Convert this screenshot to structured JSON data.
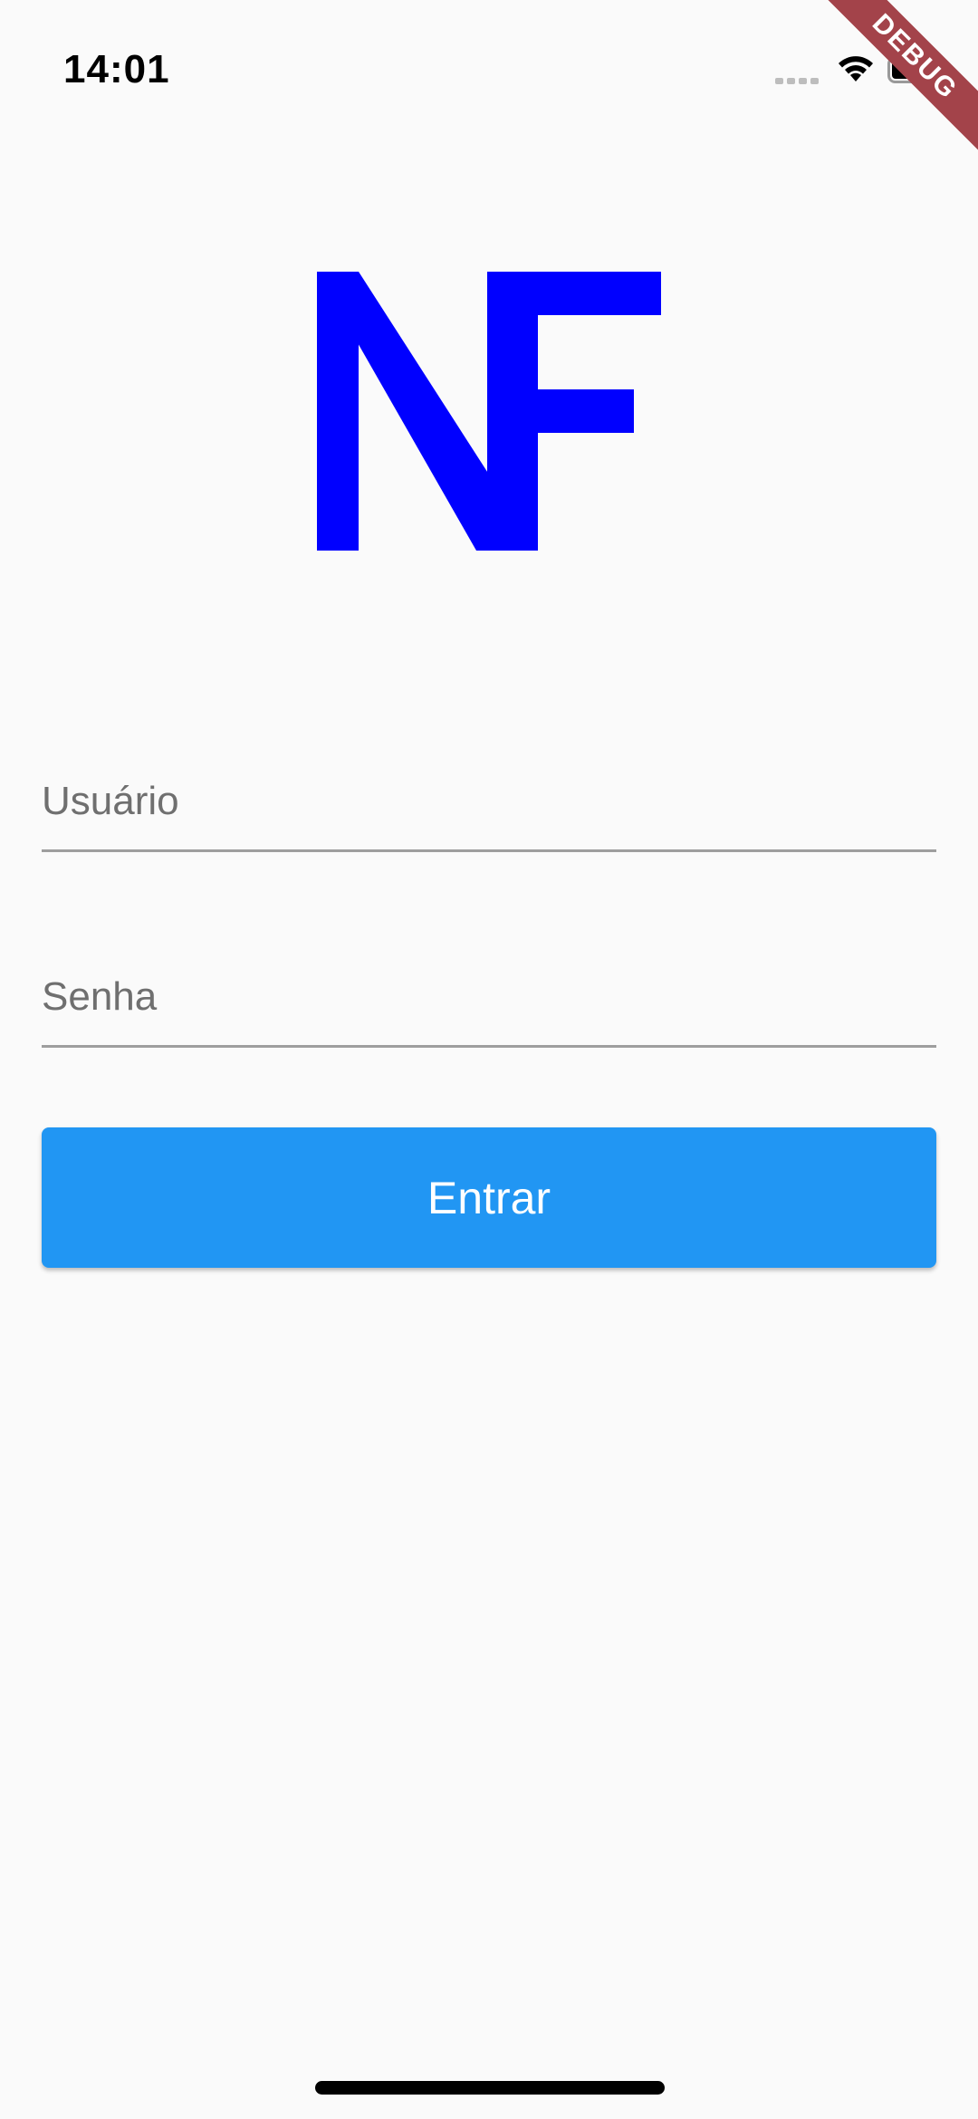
{
  "status_bar": {
    "time": "14:01",
    "signal_icon": "cellular-signal-icon",
    "wifi_icon": "wifi-icon",
    "battery_icon": "battery-icon"
  },
  "debug_banner": {
    "label": "DEBUG"
  },
  "logo": {
    "text": "NF",
    "color": "#0000ff"
  },
  "login_form": {
    "username_placeholder": "Usuário",
    "username_value": "",
    "password_placeholder": "Senha",
    "password_value": "",
    "submit_label": "Entrar"
  },
  "colors": {
    "background": "#fafafa",
    "button": "#2196f3",
    "button_text": "#ffffff",
    "underline": "#9e9e9e",
    "debug_ribbon": "#a3434a"
  }
}
